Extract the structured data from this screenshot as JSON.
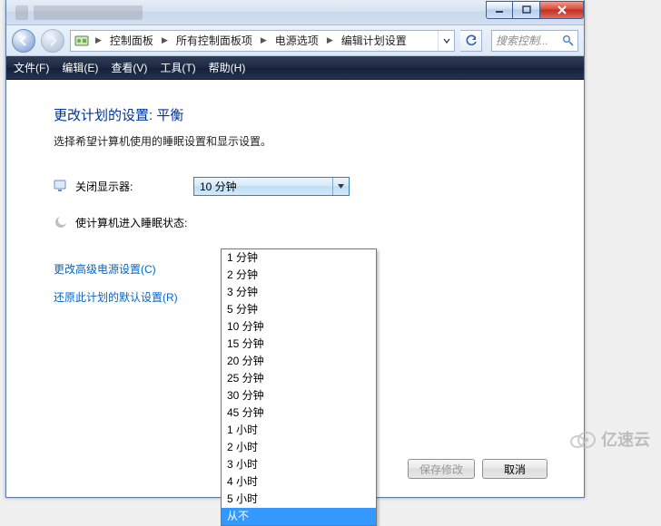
{
  "titlebar": {
    "minimize_tip": "最小化",
    "maximize_tip": "最大化",
    "close_tip": "关闭"
  },
  "nav": {
    "back_tip": "后退",
    "forward_tip": "前进",
    "breadcrumb": [
      "控制面板",
      "所有控制面板项",
      "电源选项",
      "编辑计划设置"
    ],
    "refresh_tip": "刷新",
    "search_placeholder": "搜索控制..."
  },
  "menu": {
    "file": "文件(F)",
    "edit": "编辑(E)",
    "view": "查看(V)",
    "tools": "工具(T)",
    "help": "帮助(H)"
  },
  "page": {
    "heading": "更改计划的设置: 平衡",
    "subtext": "选择希望计算机使用的睡眠设置和显示设置。",
    "display_off_label": "关闭显示器:",
    "display_off_value": "10 分钟",
    "sleep_label": "使计算机进入睡眠状态:",
    "advanced_link": "更改高级电源设置(C)",
    "restore_link": "还原此计划的默认设置(R)",
    "save_btn": "保存修改",
    "cancel_btn": "取消"
  },
  "dropdown": {
    "options": [
      "1 分钟",
      "2 分钟",
      "3 分钟",
      "5 分钟",
      "10 分钟",
      "15 分钟",
      "20 分钟",
      "25 分钟",
      "30 分钟",
      "45 分钟",
      "1 小时",
      "2 小时",
      "3 小时",
      "4 小时",
      "5 小时",
      "从不"
    ],
    "highlighted": "从不"
  },
  "watermark": "亿速云"
}
